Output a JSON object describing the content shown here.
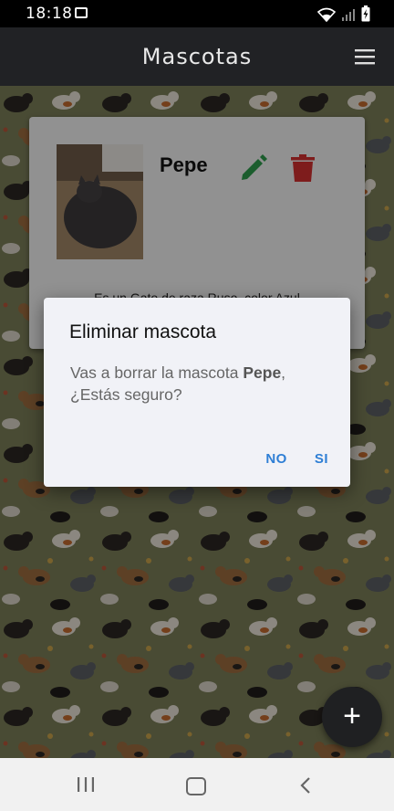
{
  "status_bar": {
    "time": "18:18"
  },
  "app_bar": {
    "title": "Mascotas"
  },
  "pet_card": {
    "name": "Pepe",
    "description": "Es un Gato de raza Ruso, color Azul"
  },
  "dialog": {
    "title": "Eliminar mascota",
    "message_prefix": "Vas a borrar la mascota ",
    "message_pet": "Pepe",
    "message_suffix": ", ¿Estás seguro?",
    "no_label": "NO",
    "yes_label": "SI"
  },
  "fab": {
    "label": "+"
  },
  "colors": {
    "app_bar": "#212225",
    "edit_icon": "#2e9b4b",
    "delete_icon": "#d32f2f",
    "dialog_button": "#2f7fd5",
    "fab": "#1f2022"
  },
  "icons": {
    "menu": "hamburger-menu-icon",
    "edit": "pencil-icon",
    "delete": "trash-icon",
    "fab": "plus-icon"
  }
}
